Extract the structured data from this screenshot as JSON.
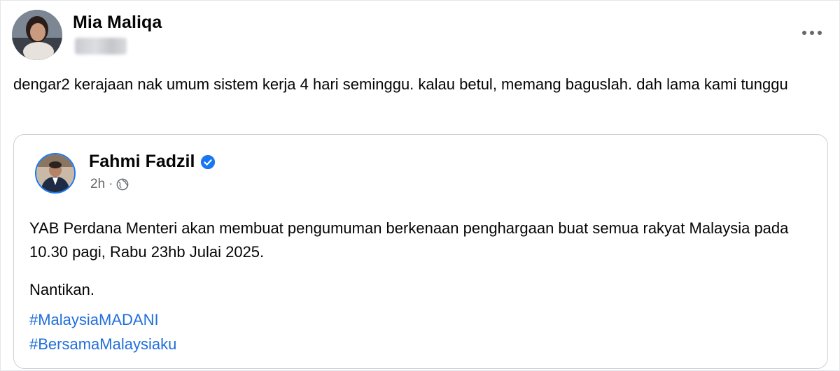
{
  "post": {
    "author_name": "Mia Maliqa",
    "text": "dengar2 kerajaan nak umum sistem kerja 4 hari seminggu. kalau betul, memang baguslah. dah lama kami tunggu",
    "more_icon": "more-horizontal-icon"
  },
  "shared": {
    "author_name": "Fahmi Fadzil",
    "verified_icon": "verified-badge-icon",
    "time": "2h",
    "separator": "·",
    "audience_icon": "globe-icon",
    "paragraph1": "YAB Perdana Menteri akan membuat pengumuman berkenaan penghargaan buat semua rakyat Malaysia pada 10.30 pagi, Rabu 23hb Julai 2025.",
    "paragraph2": "Nantikan.",
    "hashtags": [
      "#MalaysiaMADANI",
      "#BersamaMalaysiaku"
    ]
  },
  "colors": {
    "link": "#216fdb",
    "verified": "#1877f2",
    "secondary_text": "#65676b",
    "border": "#ced0d4"
  }
}
